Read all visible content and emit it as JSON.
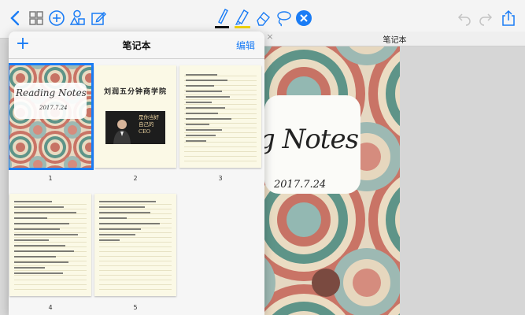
{
  "notebook": {
    "title": "笔记本",
    "edit_label": "编辑",
    "add_label": "+"
  },
  "document": {
    "title": "笔记本",
    "close_label": "×",
    "cover_text": "g Notes",
    "cover_date": "2017.7.24"
  },
  "pages": [
    {
      "number": "1",
      "kind": "cover",
      "cover_text": "Reading Notes",
      "cover_date": "2017.7.24",
      "selected": true
    },
    {
      "number": "2",
      "kind": "promo",
      "heading": "刘润五分钟商学院",
      "poster_text": "是你当好自己的CEO"
    },
    {
      "number": "3",
      "kind": "handwritten"
    },
    {
      "number": "4",
      "kind": "handwritten"
    },
    {
      "number": "5",
      "kind": "handwritten"
    }
  ],
  "toolbar": {
    "tools": [
      "back-icon",
      "thumbnails-icon",
      "add-icon",
      "shapes-icon",
      "compose-icon",
      "pen-icon",
      "highlighter-icon",
      "eraser-icon",
      "lasso-icon",
      "close-tool-icon",
      "undo-icon",
      "redo-icon",
      "share-icon"
    ],
    "accent": "#1a7cf5",
    "pen_color": "#111111",
    "highlighter_color": "#f0d400"
  }
}
